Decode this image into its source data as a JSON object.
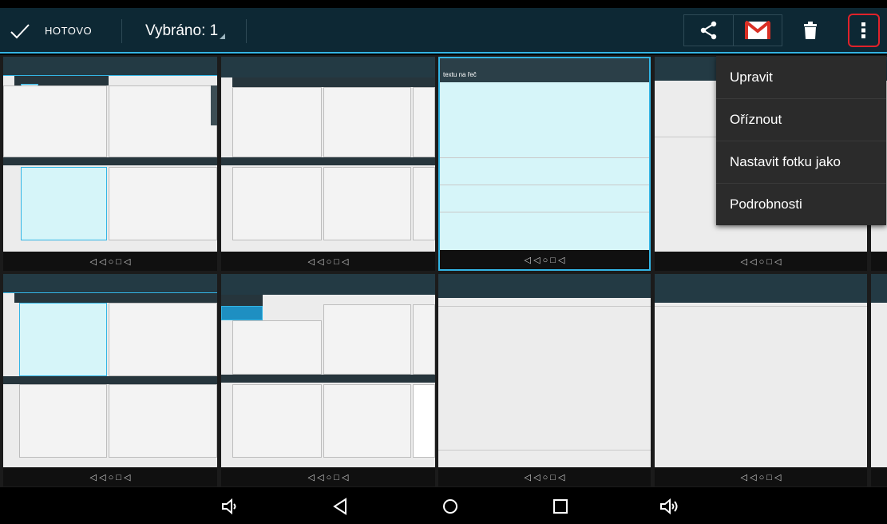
{
  "action_bar": {
    "done_label": "HOTOVO",
    "selected_label": "Vybráno: 1",
    "icons": [
      "check-icon",
      "share-icon",
      "gmail-icon",
      "trash-icon",
      "overflow-menu-icon"
    ],
    "accent": "#33b5e5",
    "bar_color": "#0d2834",
    "highlight_color": "#e0222a"
  },
  "overflow_menu": {
    "items": [
      {
        "label": "Upravit"
      },
      {
        "label": "Oříznout"
      },
      {
        "label": "Nastavit fotku jako"
      },
      {
        "label": "Podrobnosti"
      }
    ]
  },
  "grid": {
    "selected_tile_caption": "textu na řeč",
    "tile_count": 8,
    "selected_index": 2
  },
  "system_nav": {
    "icons": [
      "volume-down-icon",
      "back-icon",
      "home-icon",
      "recents-icon",
      "volume-up-icon"
    ]
  }
}
